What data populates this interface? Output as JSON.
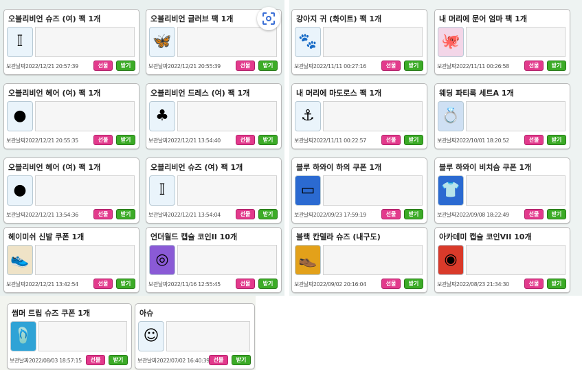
{
  "labels": {
    "stored_date_prefix": "보관날짜",
    "gift_button": "선물",
    "receive_button": "받기"
  },
  "colors": {
    "gift_button": "#e23a8c",
    "receive_button": "#3cab27"
  },
  "items": [
    {
      "name": "오블리비언 슈즈 (여) 팩 1개",
      "date": "2022/12/21 20:57:39",
      "icon": "boots-icon"
    },
    {
      "name": "오블리비언 글러브 팩 1개",
      "date": "2022/12/21 20:55:39",
      "icon": "wings-icon"
    },
    {
      "name": "오블리비언 헤어 (여) 팩 1개",
      "date": "2022/12/21 20:55:35",
      "icon": "hair-icon"
    },
    {
      "name": "오블리비언 드레스 (여) 팩 1개",
      "date": "2022/12/21 13:54:40",
      "icon": "dress-icon"
    },
    {
      "name": "오블리비언 헤어 (여) 팩 1개",
      "date": "2022/12/21 13:54:36",
      "icon": "hair-icon"
    },
    {
      "name": "오블리비언 슈즈 (여) 팩 1개",
      "date": "2022/12/21 13:54:04",
      "icon": "boots-icon"
    },
    {
      "name": "헤이미쉬 신발 쿠폰 1개",
      "date": "2022/12/21 13:42:54",
      "icon": "shoe-coupon-icon"
    },
    {
      "name": "언더월드 캡슐 코인II 10개",
      "date": "2022/11/16 12:55:45",
      "icon": "coin-icon"
    },
    {
      "name": "강아지 귀 (화이트) 팩 1개",
      "date": "2022/11/11 00:27:16",
      "icon": "dog-ears-icon"
    },
    {
      "name": "내 머리에 문어 엄마 팩 1개",
      "date": "2022/11/11 00:26:58",
      "icon": "octopus-icon"
    },
    {
      "name": "내 머리에 마도로스 팩 1개",
      "date": "2022/11/11 00:22:57",
      "icon": "sailor-hat-icon"
    },
    {
      "name": "웨딩 파티룩 세트A 1개",
      "date": "2022/10/01 18:20:52",
      "icon": "wedding-set-icon"
    },
    {
      "name": "블루 하와이 하의 쿠폰 1개",
      "date": "2022/09/23 17:59:19",
      "icon": "pants-coupon-icon"
    },
    {
      "name": "블루 하와이 비치슴 쿠폰 1개",
      "date": "2022/09/08 18:22:49",
      "icon": "shirt-coupon-icon"
    },
    {
      "name": "블랙 칸델라 슈즈 (내구도)",
      "date": "2022/09/02 20:16:04",
      "icon": "black-shoes-icon"
    },
    {
      "name": "아카데미 캡슐 코인VII 10개",
      "date": "2022/08/23 21:34:30",
      "icon": "gold-coin-icon"
    },
    {
      "name": "썸머 트립 슈즈 쿠폰 1개",
      "date": "2022/08/03 18:57:15",
      "icon": "sandal-coupon-icon"
    },
    {
      "name": "아슈",
      "date": "2022/07/02 16:40:39",
      "icon": "character-icon"
    }
  ]
}
